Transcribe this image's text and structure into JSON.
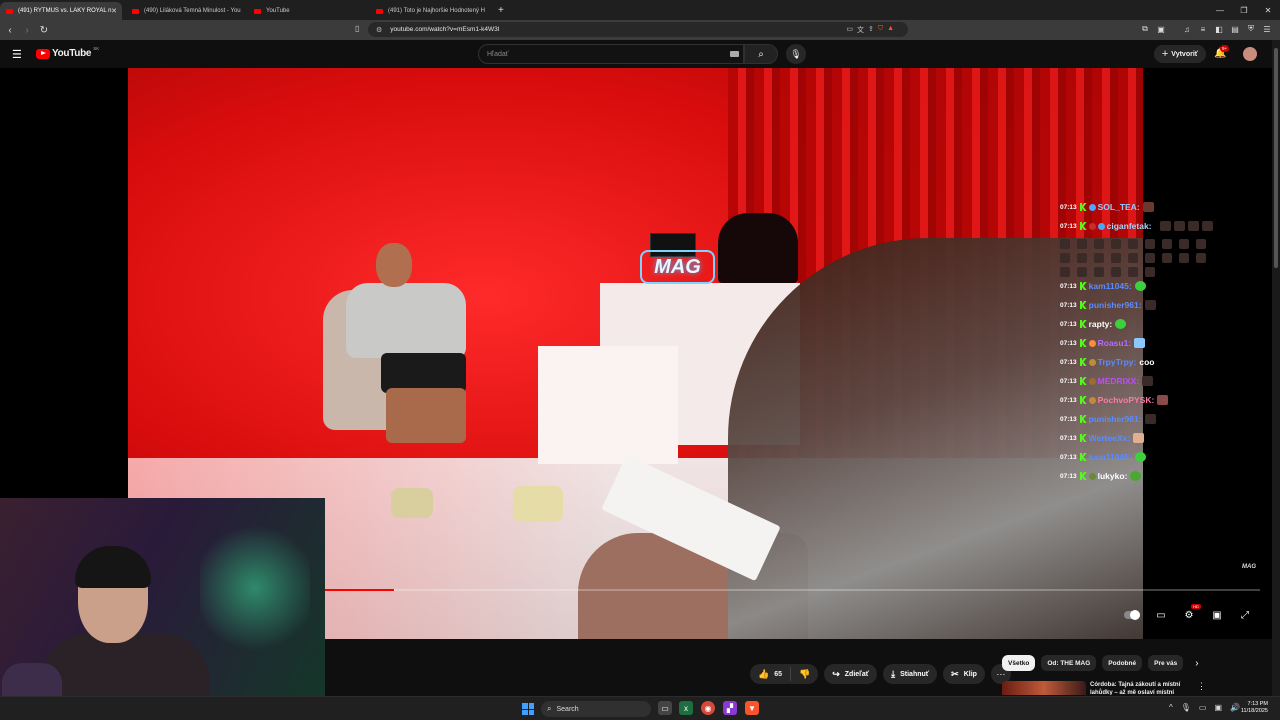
{
  "tabs": [
    {
      "title": "(491) RYTMUS vs. LAKY ROYAL n",
      "active": true
    },
    {
      "title": "(490) Liláková Temná Minulost - You",
      "active": false
    },
    {
      "title": "YouTube",
      "active": false
    },
    {
      "title": "(491) Toto je Najhoršie Hodnotený H",
      "active": false
    }
  ],
  "new_tab": "+",
  "url": "youtube.com/watch?v=mEsm1-k4W3I",
  "youtube": {
    "logo_text": "YouTube",
    "country": "SK",
    "search_placeholder": "Hľadať",
    "create_label": "Vytvoriť",
    "notification_badge": "9+"
  },
  "video": {
    "sign_text": "MAG",
    "watermark": "MAG",
    "progress_fraction": 0.074,
    "buffer_fraction": 0.075,
    "hd_badge": "HD"
  },
  "chat": [
    {
      "time": "07:13",
      "user": "SOL_TEA",
      "color": "#7fb8ff",
      "text": ""
    },
    {
      "time": "07:13",
      "user": "ciganfetak",
      "color": "#9ed8ff",
      "text": ""
    },
    {
      "time": "07:13",
      "user": "kam11045",
      "color": "#5b8cff",
      "text": ""
    },
    {
      "time": "07:13",
      "user": "punisher961",
      "color": "#5b8cff",
      "text": ""
    },
    {
      "time": "07:13",
      "user": "rapty",
      "color": "#ffffff",
      "text": ""
    },
    {
      "time": "07:13",
      "user": "Roasu1",
      "color": "#b46cff",
      "text": ""
    },
    {
      "time": "07:13",
      "user": "TrpyTrpy",
      "color": "#5b8cff",
      "text": "coo"
    },
    {
      "time": "07:13",
      "user": "MEDRIXX",
      "color": "#c04cff",
      "text": ""
    },
    {
      "time": "07:13",
      "user": "PochvoPYSK",
      "color": "#ff7aa8",
      "text": ""
    },
    {
      "time": "07:13",
      "user": "punisher961",
      "color": "#5b8cff",
      "text": ""
    },
    {
      "time": "07:13",
      "user": "WerteeXx",
      "color": "#5b8cff",
      "text": ""
    },
    {
      "time": "07:13",
      "user": "kam11045",
      "color": "#5b8cff",
      "text": ""
    },
    {
      "time": "07:13",
      "user": "lukyko",
      "color": "#ffffff",
      "text": ""
    }
  ],
  "actions": {
    "like_count": "65",
    "share": "Zdieľať",
    "download": "Stiahnuť",
    "clip": "Klip"
  },
  "chips": [
    "Všetko",
    "Od: THE MAG",
    "Podobné",
    "Pre vás"
  ],
  "recommendation": {
    "title": "Córdoba: Tajná zákoutí a místní lahůdky – až mě oslaví místní"
  },
  "taskbar": {
    "search_label": "Search",
    "time": "7:13 PM",
    "date": "11/18/2025"
  }
}
